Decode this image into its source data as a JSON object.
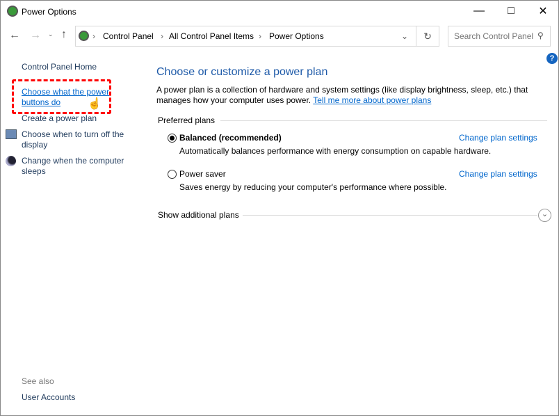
{
  "window": {
    "title": "Power Options"
  },
  "address": {
    "crumbs": [
      "Control Panel",
      "All Control Panel Items",
      "Power Options"
    ],
    "search_placeholder": "Search Control Panel"
  },
  "sidebar": {
    "home": "Control Panel Home",
    "links": [
      "Choose what the power buttons do",
      "Create a power plan",
      "Choose when to turn off the display",
      "Change when the computer sleeps"
    ],
    "see_also": "See also",
    "user_accounts": "User Accounts"
  },
  "main": {
    "title": "Choose or customize a power plan",
    "intro": "A power plan is a collection of hardware and system settings (like display brightness, sleep, etc.) that manages how your computer uses power.",
    "intro_link": "Tell me more about power plans",
    "preferred": "Preferred plans",
    "plans": [
      {
        "name": "Balanced (recommended)",
        "desc": "Automatically balances performance with energy consumption on capable hardware.",
        "action": "Change plan settings",
        "selected": true
      },
      {
        "name": "Power saver",
        "desc": "Saves energy by reducing your computer's performance where possible.",
        "action": "Change plan settings",
        "selected": false
      }
    ],
    "additional": "Show additional plans"
  },
  "colors": {
    "accent": "#0066cc",
    "title": "#1e5aa8",
    "highlight": "#ff0000"
  }
}
